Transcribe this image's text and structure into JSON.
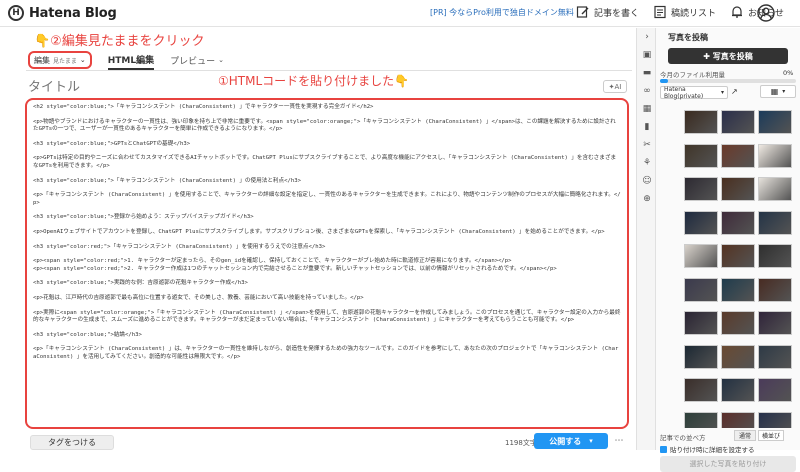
{
  "topbar": {
    "logo_text": "Hatena Blog",
    "promo": "[PR] 今ならPro利用で独自ドメイン無料",
    "write_label": "記事を書く",
    "drafts_label": "稿読リスト",
    "notify_label": "お知らせ"
  },
  "editor": {
    "annotation_top": "👇②編集見たままをクリック",
    "annotation_html": "①HTMLコードを貼り付けました👇",
    "mode_select_label": "編集",
    "mode_select_sub": "見たまま",
    "tab_html": "HTML編集",
    "tab_preview": "プレビュー",
    "title_placeholder": "タイトル",
    "ai_label": "AI",
    "code_lines": [
      {
        "text": "<h2 style=\"color:blue;\">「キャラコンシステント (CharaConsistent) 」でキャラクター一貫性を実現する完全ガイド</h2>",
        "gap": false
      },
      {
        "text": "<p>物語やブランドにおけるキャラクターの一貫性は、強い印象を持ち上で非常に重要です。<span style=\"color:orange;\">「キャラコンシステント (CharaConsistent) 」</span>は、この課題を解決するために設計されたGPTsの一つで、ユーザーが一貫性のあるキャラクターを簡単に作成できるようになります。</p>",
        "gap": true
      },
      {
        "text": "<h3 style=\"color:blue;\">GPTsとChatGPTの基礎</h3>",
        "gap": true
      },
      {
        "text": "<p>GPTsは特定の目的やニーズに合わせてカスタマイズできるAIチャットボットです。ChatGPT Plusにサブスクライブすることで、より高度な機能にアクセスし、「キャラコンシステント (CharaConsistent) 」を含むさまざまなGPTsを利用できます。</p>",
        "gap": true
      },
      {
        "text": "<h3 style=\"color:blue;\">「キャラコンシステント (CharaConsistent) 」の使用法と利点</h3>",
        "gap": true
      },
      {
        "text": "<p>「キャラコンシステント (CharaConsistent) 」を使用することで、キャラクターの詳細な設定を指定し、一貫性のあるキャラクターを生成できます。これにより、物語やコンテンツ制作のプロセスが大幅に簡略化されます。</p>",
        "gap": true
      },
      {
        "text": "<h3 style=\"color:blue;\">登録から始めよう：ステップバイステップガイド</h3>",
        "gap": true
      },
      {
        "text": "<p>OpenAIウェブサイトでアカウントを登録し、ChatGPT Plusにサブスクライブします。サブスクリプション後、さまざまなGPTsを探索し、「キャラコンシステント (CharaConsistent) 」を始めることができます。</p>",
        "gap": true
      },
      {
        "text": "<h3 style=\"color:red;\">「キャラコンシステント (CharaConsistent) 」を使用するうえでの注意点</h3>",
        "gap": true
      },
      {
        "text": "<p><span style=\"color:red;\">1. キャラクターが定まったら、そのgen_idを確認し、保持しておくことで、キャラクターがブレ始めた時に軌道修正が容易になります。</span></p>",
        "gap": true
      },
      {
        "text": "<p><span style=\"color:red;\">2. キャラクター作成は1つのチャットセッション内で完結させることが重要です。新しいチャットセッションでは、以前の情報がリセットされるためです。</span></p>",
        "gap": false
      },
      {
        "text": "<h3 style=\"color:blue;\">実践的な例：吉原遊郭の花魁キャラクター作成</h3>",
        "gap": true
      },
      {
        "text": "<p>花魁は、江戸時代の吉原遊郭で最も高位に位置する遊女で、その美しさ、教養、芸能において高い技能を持っていました。</p>",
        "gap": true
      },
      {
        "text": "<p>実際に<span style=\"color:orange;\">「キャラコンシステント (CharaConsistent) 」</span>を使用して、吉原遊郭の花魁キャラクターを作成してみましょう。このプロセスを通じて、キャラクター設定の入力から最終的なキャラクターの生成まで、スムーズに進めることができます。キャラクターがまだ定まっていない場合は、「キャラコンシステント (CharaConsistent) 」にキャラクターを考えてもらうことも可能です。</p>",
        "gap": true
      },
      {
        "text": "<h3 style=\"color:blue;\">結論</h3>",
        "gap": true
      },
      {
        "text": "<p>「キャラコンシステント (CharaConsistent) 」は、キャラクターの一貫性を維持しながら、創造性を発揮するための強力なツールです。このガイドを参考にして、あなたの次のプロジェクトで「キャラコンシステント (CharaConsistent) 」を活用してみてください。創造的な可能性は無限大です。</p>",
        "gap": true
      }
    ]
  },
  "bottombar": {
    "tag_label": "タグをつける",
    "char_count": "1198文字",
    "publish_label": "公開する"
  },
  "sidebar": {
    "title": "写真を投稿",
    "upload_label": "✚ 写真を投稿",
    "usage_label": "今月のファイル利用量",
    "usage_value": "0%",
    "usage_fraction": 0.06,
    "album": "Hatena Blog(private)",
    "sort_label": "記事での並べ方",
    "sort_options": [
      "通常",
      "横並び"
    ],
    "check_label": "貼り付け時に詳細を設定する",
    "paste_label": "選択した写真を貼り付け",
    "thumb_colors": [
      "#3a2a1f",
      "#2b2f4a",
      "#1c3b5a",
      "#403529",
      "#6b3a2a",
      "#efe9e2",
      "#2d2a32",
      "#4a2f1f",
      "#e6e2dc",
      "#1e2a3f",
      "#3f2b3a",
      "#243447",
      "#d8d2cb",
      "#553322",
      "#2f2f2f",
      "#3b3a4d",
      "#1f3c4d",
      "#482b22",
      "#2a2433",
      "#5a3b2b",
      "#30243a",
      "#1c2833",
      "#6a4a32",
      "#2e3a46",
      "#3a2e2a",
      "#233142",
      "#4b3b5a",
      "#2d3f3a",
      "#5b2e2a",
      "#26304a",
      "#38302e",
      "#1f2c3a"
    ]
  }
}
